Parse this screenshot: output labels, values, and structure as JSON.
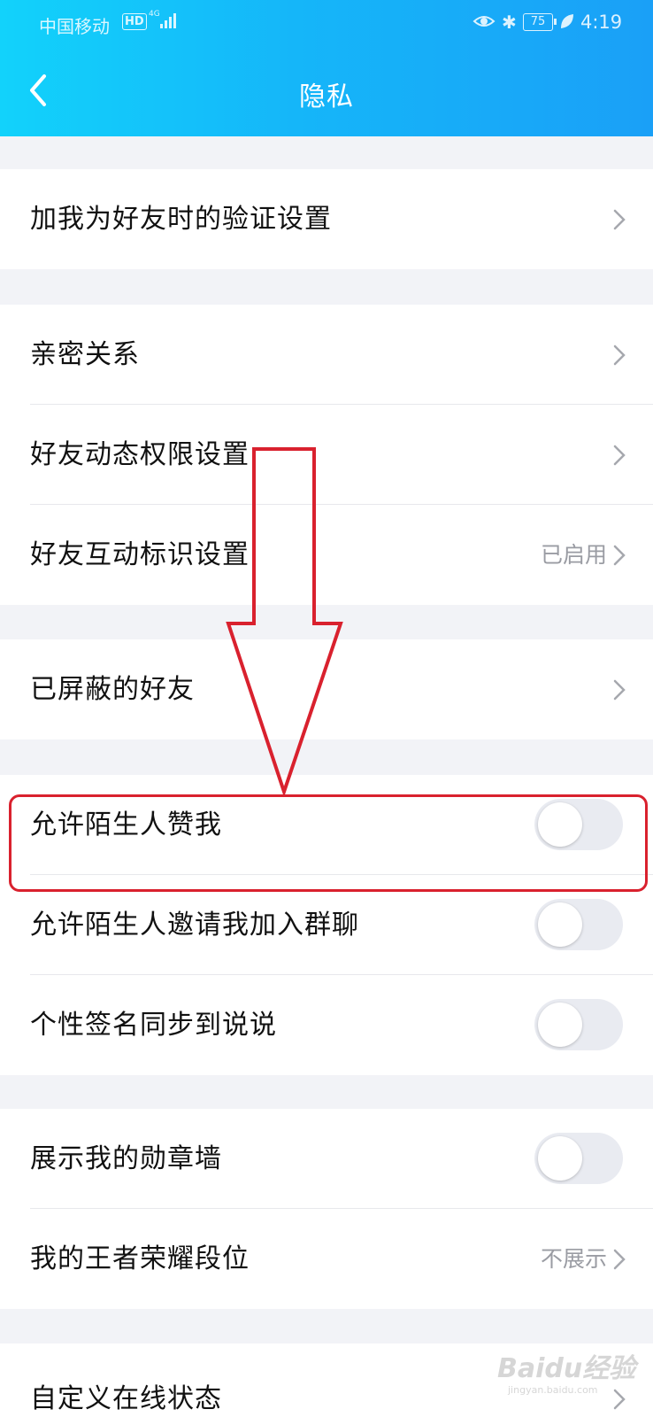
{
  "status_bar": {
    "carrier": "中国移动",
    "hd": "HD",
    "network": "4G",
    "battery": "75",
    "time": "4:19"
  },
  "header": {
    "title": "隐私",
    "back_icon": "chevron-left-icon"
  },
  "sections": [
    {
      "items": [
        {
          "label": "加我为好友时的验证设置",
          "type": "link"
        }
      ]
    },
    {
      "items": [
        {
          "label": "亲密关系",
          "type": "link"
        },
        {
          "label": "好友动态权限设置",
          "type": "link"
        },
        {
          "label": "好友互动标识设置",
          "type": "link",
          "value": "已启用"
        }
      ]
    },
    {
      "items": [
        {
          "label": "已屏蔽的好友",
          "type": "link"
        }
      ]
    },
    {
      "items": [
        {
          "label": "允许陌生人赞我",
          "type": "toggle",
          "on": false
        },
        {
          "label": "允许陌生人邀请我加入群聊",
          "type": "toggle",
          "on": false
        },
        {
          "label": "个性签名同步到说说",
          "type": "toggle",
          "on": false
        }
      ]
    },
    {
      "items": [
        {
          "label": "展示我的勋章墙",
          "type": "toggle",
          "on": false
        },
        {
          "label": "我的王者荣耀段位",
          "type": "link",
          "value": "不展示"
        }
      ]
    },
    {
      "items": [
        {
          "label": "自定义在线状态",
          "type": "link"
        }
      ]
    }
  ],
  "annotation": {
    "color": "#d9212e",
    "arrow_icon": "down-arrow-icon",
    "highlighted_item": "允许陌生人赞我"
  },
  "watermark": {
    "brand": "Baidu经验",
    "url": "jingyan.baidu.com"
  },
  "colors": {
    "header_start": "#12d2fb",
    "header_end": "#1aa0f7",
    "toggle_off": "#e9ebf1"
  }
}
